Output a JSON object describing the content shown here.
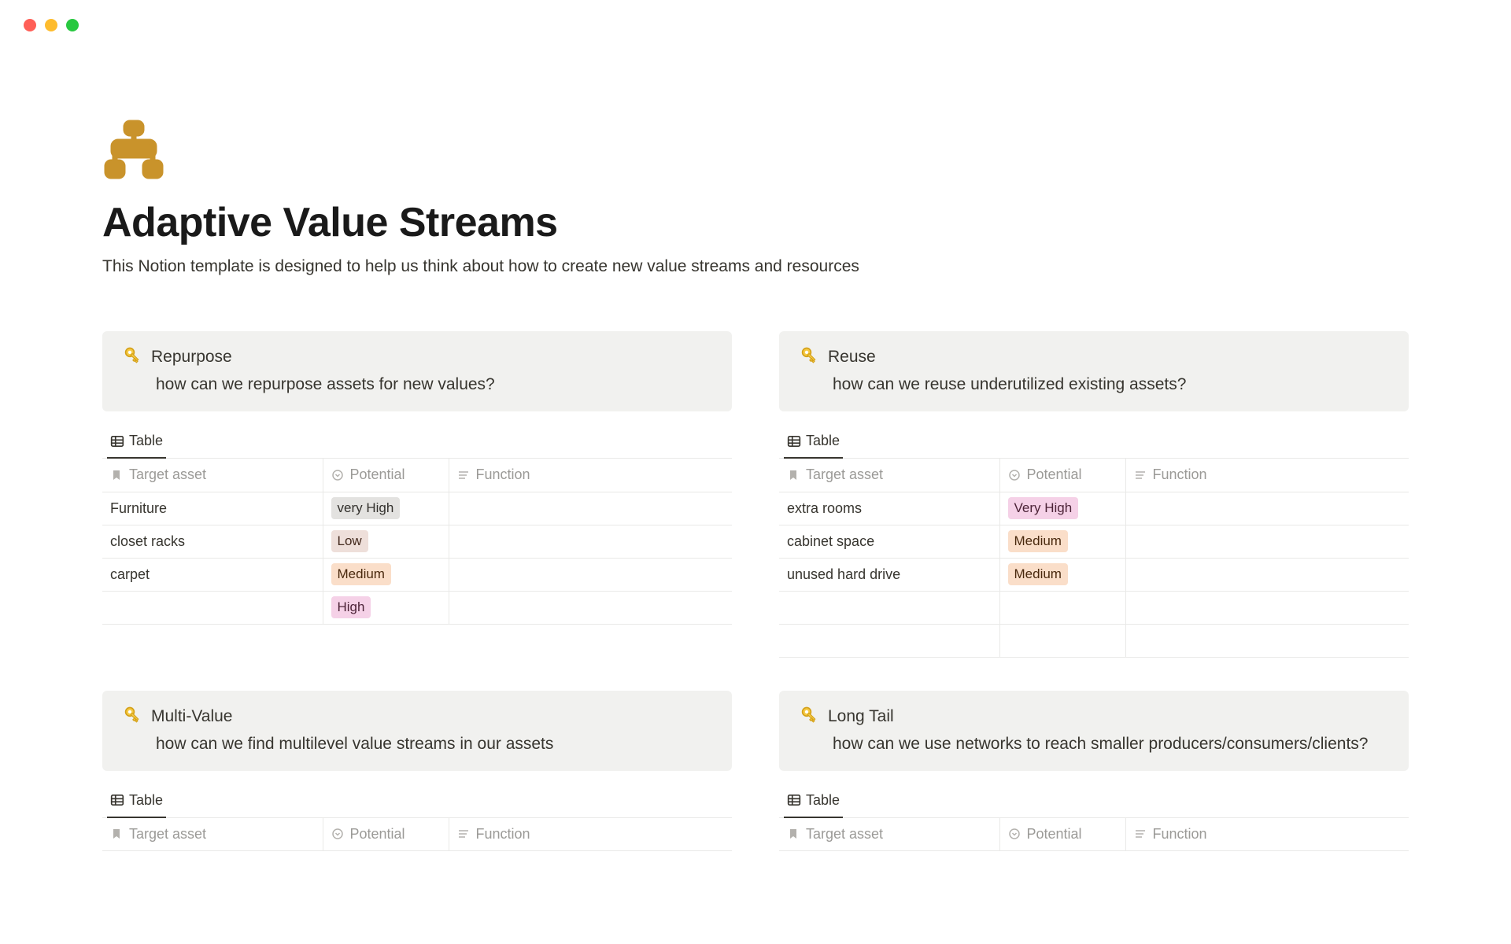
{
  "page": {
    "title": "Adaptive Value Streams",
    "subtitle": "This Notion template is designed to help us think about how to create new value streams and resources"
  },
  "sections": {
    "repurpose": {
      "title": "Repurpose",
      "text": "how can we repurpose assets for new values?",
      "view_label": "Table",
      "columns": {
        "asset": "Target asset",
        "potential": "Potential",
        "function": "Function"
      },
      "rows": [
        {
          "asset": "Furniture",
          "potential": "very High",
          "potential_color": "gray"
        },
        {
          "asset": "closet racks",
          "potential": "Low",
          "potential_color": "brown"
        },
        {
          "asset": "carpet",
          "potential": "Medium",
          "potential_color": "orange"
        },
        {
          "asset": "",
          "potential": "High",
          "potential_color": "pink"
        }
      ]
    },
    "reuse": {
      "title": "Reuse",
      "text": "how can we reuse underutilized existing assets?",
      "view_label": "Table",
      "columns": {
        "asset": "Target asset",
        "potential": "Potential",
        "function": "Function"
      },
      "rows": [
        {
          "asset": "extra rooms",
          "potential": "Very High",
          "potential_color": "pink"
        },
        {
          "asset": "cabinet space",
          "potential": "Medium",
          "potential_color": "orange"
        },
        {
          "asset": "unused hard drive",
          "potential": "Medium",
          "potential_color": "orange"
        },
        {
          "asset": "",
          "potential": "",
          "potential_color": ""
        },
        {
          "asset": "",
          "potential": "",
          "potential_color": ""
        }
      ]
    },
    "multivalue": {
      "title": "Multi-Value",
      "text": "how can we find multilevel value streams in our assets",
      "view_label": "Table",
      "columns": {
        "asset": "Target asset",
        "potential": "Potential",
        "function": "Function"
      }
    },
    "longtail": {
      "title": "Long Tail",
      "text": "how can we use networks to reach smaller producers/consumers/clients?",
      "view_label": "Table",
      "columns": {
        "asset": "Target asset",
        "potential": "Potential",
        "function": "Function"
      }
    }
  }
}
